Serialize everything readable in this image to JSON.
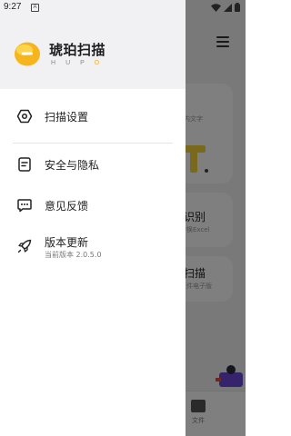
{
  "status_bar": {
    "time": "9:27",
    "notification_letter": "A"
  },
  "drawer": {
    "app_name": "琥珀扫描",
    "app_subtitle_letters": [
      "H",
      "U",
      "P",
      "O"
    ],
    "menu": [
      {
        "label": "扫描设置",
        "icon": "hexagon-settings-icon"
      },
      {
        "label": "安全与隐私",
        "icon": "document-icon"
      },
      {
        "label": "意见反馈",
        "icon": "chat-bubble-icon"
      },
      {
        "label": "版本更新",
        "icon": "rocket-icon",
        "subtitle": "当前版本 2.0.5.0"
      }
    ]
  },
  "background": {
    "card1_title": "文",
    "card1_sub": "内文字",
    "card2_title": "格识别",
    "card2_sub": "转换Excel",
    "card3_title": "件扫描",
    "card3_sub": "证件电子版",
    "tab_file_label": "文件"
  },
  "colors": {
    "accent": "#f3b21b",
    "overlay": "rgba(0,0,0,0.5)",
    "header_bg": "#f1f1f3"
  }
}
